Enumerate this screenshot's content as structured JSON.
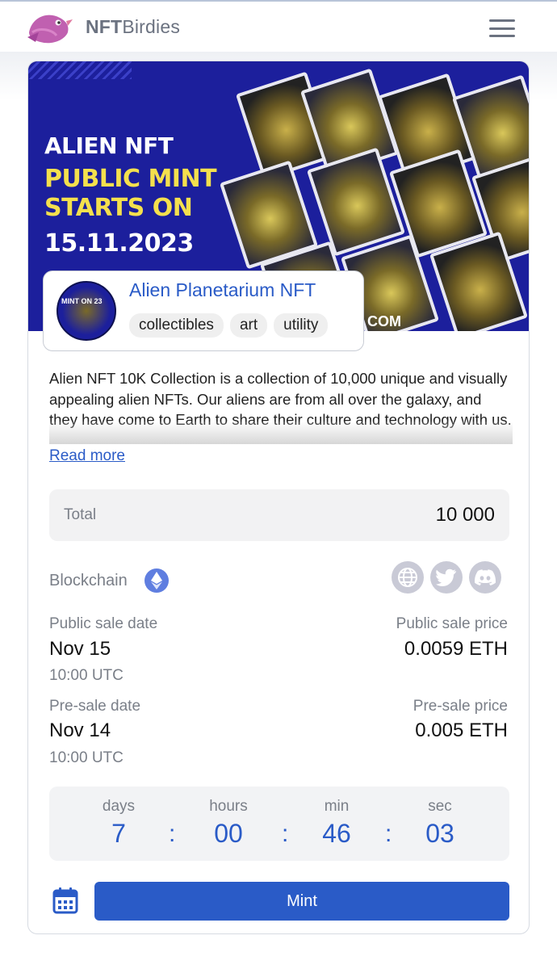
{
  "header": {
    "brand_bold": "NFT",
    "brand_rest": "Birdies",
    "logo_icon": "bird-logo-icon",
    "menu_icon": "hamburger-menu-icon"
  },
  "banner": {
    "line1": "ALIEN NFT",
    "line2": "PUBLIC MINT",
    "line3": "STARTS ON",
    "line4": "15.11.2023",
    "website_fragment": "COM",
    "colors": {
      "background": "#1c1f9c",
      "highlight": "#f4e04d"
    }
  },
  "collection": {
    "name": "Alien Planetarium NFT",
    "avatar_text": "MINT ON 23",
    "tags": [
      "collectibles",
      "art",
      "utility"
    ]
  },
  "description": {
    "text": "Alien NFT 10K Collection is a collection of 10,000 unique and visually appealing alien NFTs. Our aliens are from all over the galaxy, and they have come to Earth to share their culture and technology with us.",
    "read_more": "Read more"
  },
  "total": {
    "label": "Total",
    "value": "10 000"
  },
  "blockchain": {
    "label": "Blockchain",
    "icon": "ethereum-icon",
    "socials": [
      "globe-icon",
      "twitter-icon",
      "discord-icon"
    ]
  },
  "public_sale": {
    "date_label": "Public sale date",
    "date": "Nov 15",
    "time": "10:00 UTC",
    "price_label": "Public sale price",
    "price": "0.0059 ETH"
  },
  "pre_sale": {
    "date_label": "Pre-sale date",
    "date": "Nov 14",
    "time": "10:00 UTC",
    "price_label": "Pre-sale price",
    "price": "0.005 ETH"
  },
  "countdown": {
    "units": [
      "days",
      "hours",
      "min",
      "sec"
    ],
    "values": [
      "7",
      "00",
      "46",
      "03"
    ],
    "separator": ":"
  },
  "actions": {
    "calendar_icon": "calendar-icon",
    "mint_label": "Mint"
  },
  "colors": {
    "accent": "#2a5bc7",
    "muted_text": "#7a7f88",
    "panel_bg": "#f2f2f3"
  }
}
